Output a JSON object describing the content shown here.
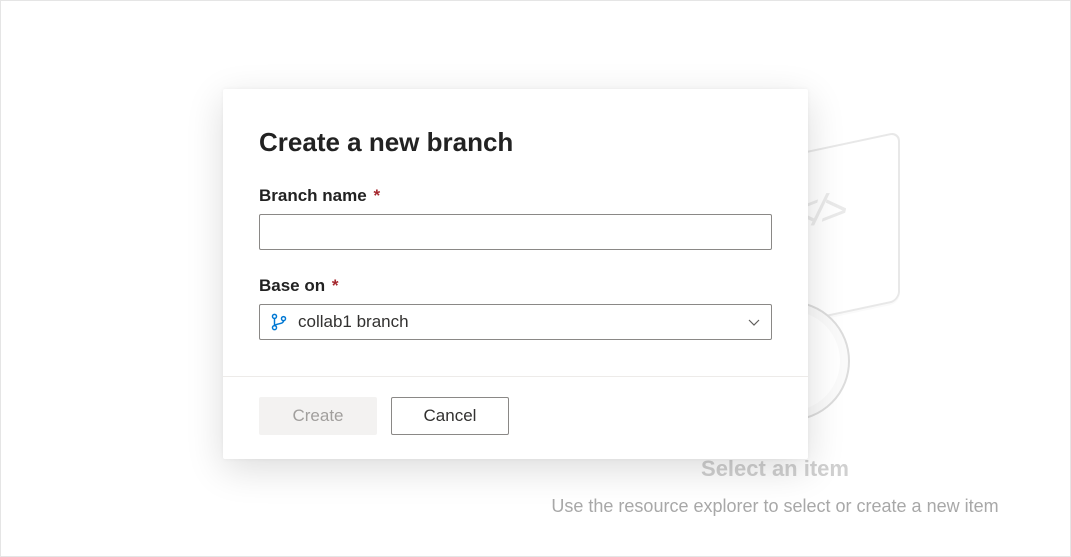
{
  "background": {
    "title": "Select an item",
    "subtitle": "Use the resource explorer to select or create a new item"
  },
  "dialog": {
    "title": "Create a new branch",
    "branch_name": {
      "label": "Branch name",
      "required_mark": "*",
      "value": ""
    },
    "base_on": {
      "label": "Base on",
      "required_mark": "*",
      "selected": "collab1 branch"
    },
    "actions": {
      "create": "Create",
      "cancel": "Cancel"
    }
  },
  "colors": {
    "accent": "#0078d4",
    "required": "#a4262c"
  }
}
